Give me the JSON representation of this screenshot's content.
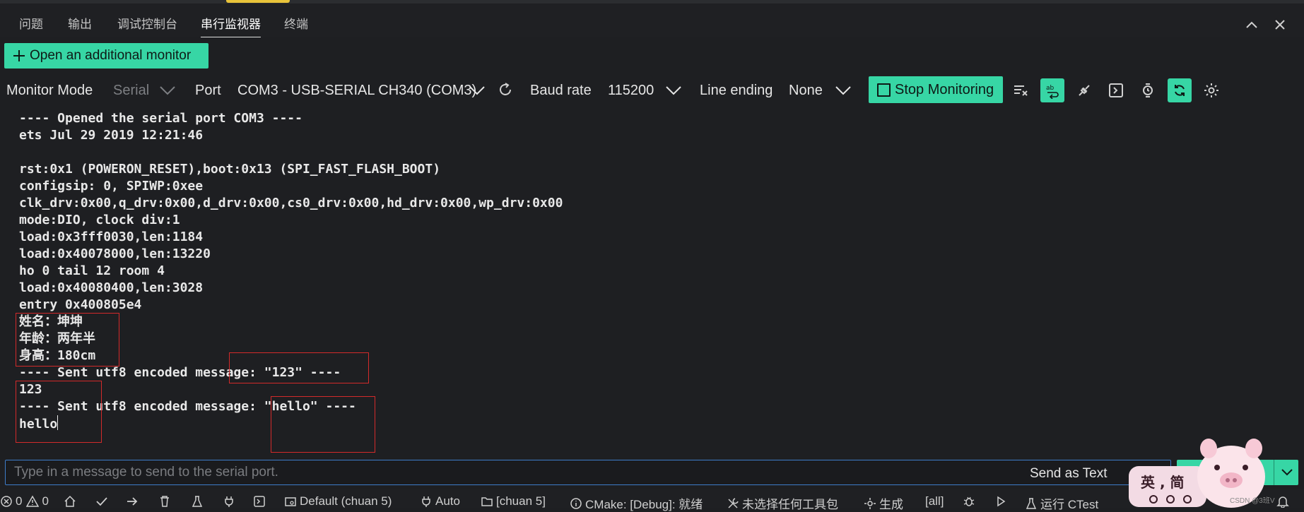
{
  "panel": {
    "tabs": [
      {
        "label": "问题",
        "active": false
      },
      {
        "label": "输出",
        "active": false
      },
      {
        "label": "调试控制台",
        "active": false
      },
      {
        "label": "串行监视器",
        "active": true
      },
      {
        "label": "终端",
        "active": false
      }
    ]
  },
  "monitor": {
    "open_additional": "Open an additional monitor",
    "mode_label": "Monitor Mode",
    "mode_value": "Serial",
    "port_label": "Port",
    "port_value": "COM3 - USB-SERIAL CH340 (COM3)",
    "baud_label": "Baud rate",
    "baud_value": "115200",
    "line_ending_label": "Line ending",
    "line_ending_value": "None",
    "stop_label": "Stop Monitoring"
  },
  "output": {
    "lines": [
      "---- Opened the serial port COM3 ----",
      "ets Jul 29 2019 12:21:46",
      "",
      "rst:0x1 (POWERON_RESET),boot:0x13 (SPI_FAST_FLASH_BOOT)",
      "configsip: 0, SPIWP:0xee",
      "clk_drv:0x00,q_drv:0x00,d_drv:0x00,cs0_drv:0x00,hd_drv:0x00,wp_drv:0x00",
      "mode:DIO, clock div:1",
      "load:0x3fff0030,len:1184",
      "load:0x40078000,len:13220",
      "ho 0 tail 12 room 4",
      "load:0x40080400,len:3028",
      "entry 0x400805e4",
      "姓名：坤坤",
      "年龄：两年半",
      "身高：180cm",
      "---- Sent utf8 encoded message: \"123\" ----",
      "123",
      "---- Sent utf8 encoded message: \"hello\" ----",
      "hello"
    ]
  },
  "input": {
    "placeholder": "Type in a message to send to the serial port.",
    "send_as": "Send as Text"
  },
  "status": {
    "errors": "0",
    "warnings": "0",
    "kit": "Default (chuan 5)",
    "auto": "Auto",
    "folder": "[chuan 5]",
    "cmake": "CMake: [Debug]: 就绪",
    "toolkit": "未选择任何工具包",
    "build": "生成",
    "target": "[all]",
    "ctest": "运行 CTest"
  },
  "overlay": {
    "sticker_text": "英 , 简",
    "watermark": "CSDN @3班V"
  },
  "colors": {
    "accent": "#37d6a5",
    "background": "#1e1f22",
    "highlight_box": "#d32a2a",
    "focus_border": "#3e7cc9"
  }
}
